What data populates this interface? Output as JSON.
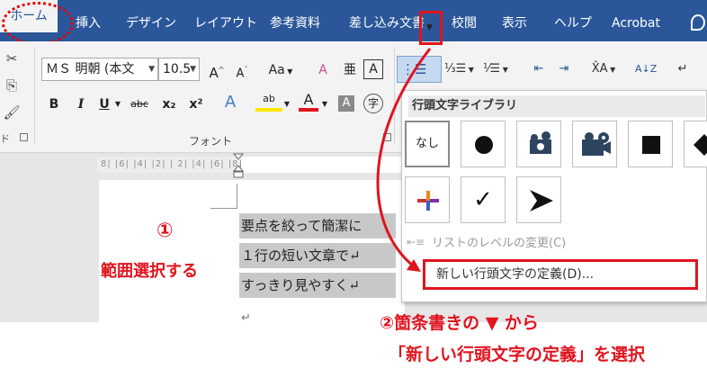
{
  "tabs": {
    "home": "ホーム",
    "items": [
      "挿入",
      "デザイン",
      "レイアウト",
      "参考資料",
      "差し込み文書",
      "校閲",
      "表示",
      "ヘルプ",
      "Acrobat"
    ]
  },
  "clipboard": {
    "group_label": "ド"
  },
  "font": {
    "name": "ＭＳ 明朝 (本文",
    "size": "10.5",
    "grow": "A",
    "shrink": "A",
    "case": "Aa",
    "clear": "A",
    "phonetic": "亜",
    "border_char": "A",
    "bold": "B",
    "italic": "I",
    "underline": "U",
    "strike": "abc",
    "sub": "x₂",
    "sup": "x²",
    "effects": "A",
    "highlight": "ab",
    "color": "A",
    "shade": "A",
    "enclose": "字",
    "group_label": "フォント"
  },
  "paragraph": {
    "bullets": "⋮☰",
    "numbering": "⅓☰",
    "multilevel": "⅟☰",
    "outdent": "⇤",
    "indent": "⇥",
    "asian": "X̂A",
    "sort": "A↓Z",
    "marks": "↵"
  },
  "ruler": {
    "text": "8| |6| |4| |2| | 2| |4| |6| |8|"
  },
  "document": {
    "lines": [
      "要点を絞って簡潔に",
      "１行の短い文章で↵",
      "すっきり見やすく↵"
    ],
    "empty_mark": "↵"
  },
  "dropdown": {
    "title": "行頭文字ライブラリ",
    "none_label": "なし",
    "cells_row2_check": "✓",
    "level_item": "リストのレベルの変更(C)",
    "define_item": "新しい行頭文字の定義(D)..."
  },
  "annotations": {
    "step1_num": "①",
    "step1_text": "範囲選択する",
    "step2_line1": "②箇条書きの ▼ から",
    "step2_line2": "「新しい行頭文字の定義」を選択"
  },
  "colors": {
    "ribbon_blue": "#2b579a",
    "annotation_red": "#e0141e"
  }
}
